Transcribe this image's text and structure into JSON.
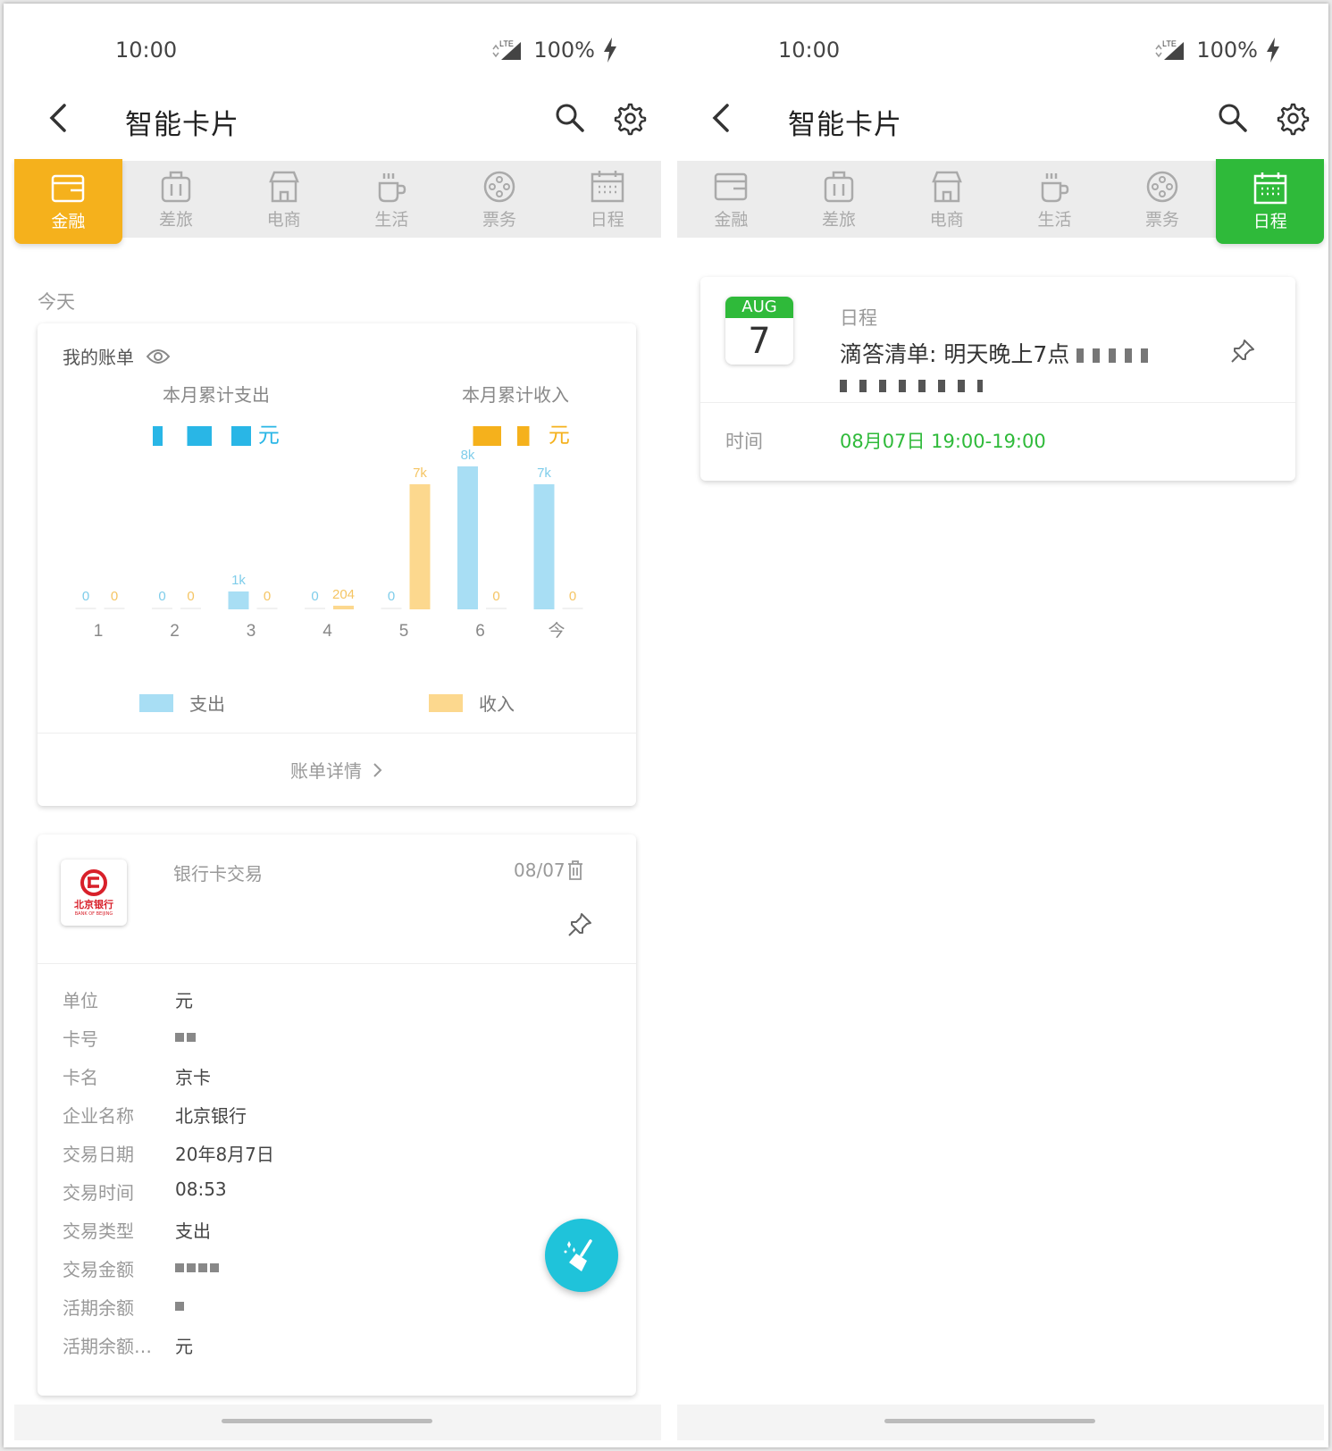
{
  "status": {
    "time": "10:00",
    "network": "LTE",
    "battery": "100%"
  },
  "header": {
    "title": "智能卡片"
  },
  "tabs": [
    {
      "label": "金融",
      "icon": "wallet-icon"
    },
    {
      "label": "差旅",
      "icon": "luggage-icon"
    },
    {
      "label": "电商",
      "icon": "store-icon"
    },
    {
      "label": "生活",
      "icon": "cup-icon"
    },
    {
      "label": "票务",
      "icon": "film-reel-icon"
    },
    {
      "label": "日程",
      "icon": "calendar-icon"
    }
  ],
  "left": {
    "active_tab": "金融",
    "section_label": "今天",
    "bill": {
      "title": "我的账单",
      "expense_label": "本月累计支出",
      "income_label": "本月累计收入",
      "unit": "元",
      "detail_link": "账单详情"
    },
    "bank": {
      "logo_text": "北京银行",
      "logo_sub": "BANK OF BEIJING",
      "type": "银行卡交易",
      "date": "08/07",
      "fields": [
        {
          "k": "单位",
          "v": "元"
        },
        {
          "k": "卡号",
          "v": ""
        },
        {
          "k": "卡名",
          "v": "京卡"
        },
        {
          "k": "企业名称",
          "v": "北京银行"
        },
        {
          "k": "交易日期",
          "v": "20年8月7日"
        },
        {
          "k": "交易时间",
          "v": "08:53"
        },
        {
          "k": "交易类型",
          "v": "支出"
        },
        {
          "k": "交易金额",
          "v": ""
        },
        {
          "k": "活期余额",
          "v": ""
        },
        {
          "k": "活期余额…",
          "v": "元"
        }
      ]
    }
  },
  "right": {
    "active_tab": "日程",
    "schedule": {
      "month": "AUG",
      "day": "7",
      "type": "日程",
      "text": "滴答清单: 明天晚上7点",
      "time_label": "时间",
      "time_value": "08月07日 19:00-19:00"
    }
  },
  "colors": {
    "expense": "#a8def4",
    "income": "#fcd88e",
    "finance": "#f5b11c",
    "schedule": "#2fba3a",
    "fab": "#1fc3da"
  },
  "chart_data": {
    "type": "bar",
    "categories": [
      "1",
      "2",
      "3",
      "4",
      "5",
      "6",
      "今"
    ],
    "series": [
      {
        "name": "支出",
        "values": [
          0,
          0,
          1000,
          0,
          0,
          8000,
          7000
        ],
        "labels": [
          "0",
          "0",
          "1k",
          "0",
          "0",
          "8k",
          "7k"
        ]
      },
      {
        "name": "收入",
        "values": [
          0,
          0,
          0,
          204,
          7000,
          0,
          0
        ],
        "labels": [
          "0",
          "0",
          "0",
          "204",
          "7k",
          "0",
          "0"
        ]
      }
    ]
  }
}
